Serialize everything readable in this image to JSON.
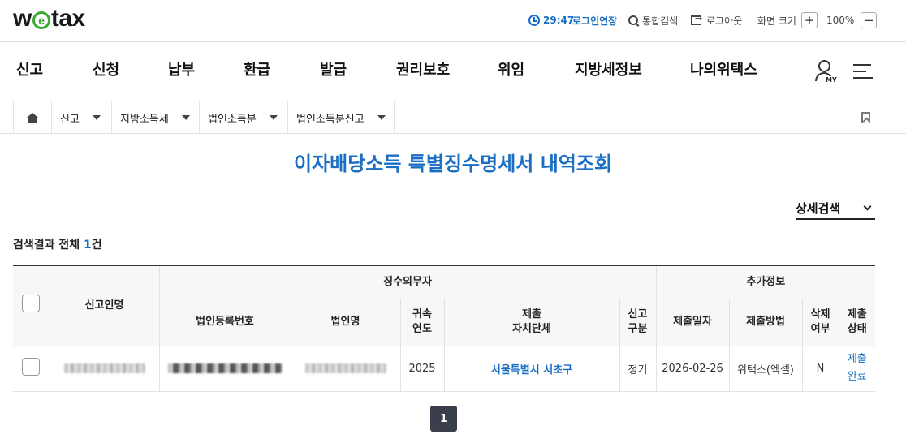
{
  "header": {
    "logo_text_1": "w",
    "logo_text_e": "e",
    "logo_text_2": "tax",
    "timer": "29:47",
    "extend_label": "로그인연장",
    "search_label": "통합검색",
    "logout_label": "로그아웃",
    "zoom_label": "화면 크기",
    "zoom_plus": "+",
    "zoom_value": "100%",
    "zoom_minus": "−"
  },
  "nav": {
    "items": [
      "신고",
      "신청",
      "납부",
      "환급",
      "발급",
      "권리보호",
      "위임",
      "지방세정보",
      "나의위택스"
    ],
    "my_label": "MY"
  },
  "breadcrumb": {
    "items": [
      "신고",
      "지방소득세",
      "법인소득분",
      "법인소득분신고"
    ]
  },
  "page": {
    "title": "이자배당소득 특별징수명세서 내역조회",
    "detail_search_label": "상세검색",
    "result_prefix": "검색결과 전체 ",
    "result_count": "1",
    "result_suffix": "건"
  },
  "table": {
    "headers": {
      "reporter_name": "신고인명",
      "withholding_group": "징수의무자",
      "extra_group": "추가정보",
      "corp_reg_no": "법인등록번호",
      "corp_name": "법인명",
      "year_line1": "귀속",
      "year_line2": "연도",
      "gov_line1": "제출",
      "gov_line2": "자치단체",
      "type_line1": "신고",
      "type_line2": "구분",
      "submit_date": "제출일자",
      "submit_method": "제출방법",
      "delete_line1": "삭제",
      "delete_line2": "여부",
      "status_line1": "제출",
      "status_line2": "상태"
    },
    "rows": [
      {
        "year": "2025",
        "gov": "서울특별시 서초구",
        "type": "정기",
        "submit_date": "2026-02-26",
        "submit_method": "위택스(엑셀)",
        "deleted": "N",
        "status_line1": "제출",
        "status_line2": "완료"
      }
    ]
  },
  "pagination": {
    "current_page": "1"
  }
}
